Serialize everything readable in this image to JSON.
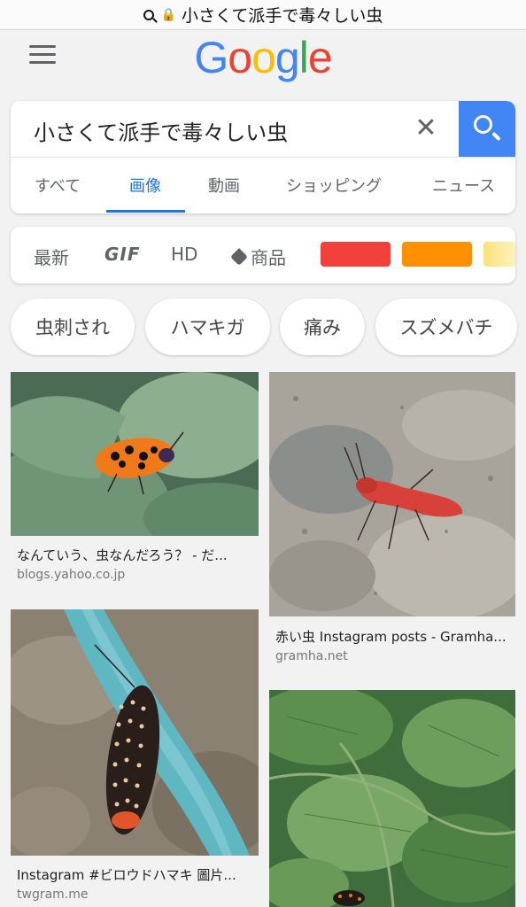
{
  "browser": {
    "url_text": "小さくて派手で毒々しい虫"
  },
  "logo": [
    "G",
    "o",
    "o",
    "g",
    "l",
    "e"
  ],
  "search": {
    "query": "小さくて派手で毒々しい虫",
    "clear_symbol": "✕"
  },
  "tabs": [
    "すべて",
    "画像",
    "動画",
    "ショッピング",
    "ニュース"
  ],
  "active_tab": "画像",
  "filters": {
    "latest": "最新",
    "gif": "GIF",
    "hd": "HD",
    "product": "商品"
  },
  "colors": {
    "accent": "#1a73e8",
    "search_button": "#4285f4",
    "swatch_red": "#f2413b",
    "swatch_orange": "#ff9100",
    "swatch_yellow": "#fce27a"
  },
  "chips": [
    "虫刺され",
    "ハマキガ",
    "痛み",
    "スズメバチ"
  ],
  "results": [
    {
      "title": "なんていう、虫なんだろう？ - だ...",
      "source": "blogs.yahoo.co.jp"
    },
    {
      "title": "赤い虫 Instagram posts - Gramha...",
      "source": "gramha.net"
    },
    {
      "title": "Instagram #ビロウドハマキ 圖片...",
      "source": "twgram.me"
    },
    {
      "title": "",
      "source": ""
    }
  ]
}
